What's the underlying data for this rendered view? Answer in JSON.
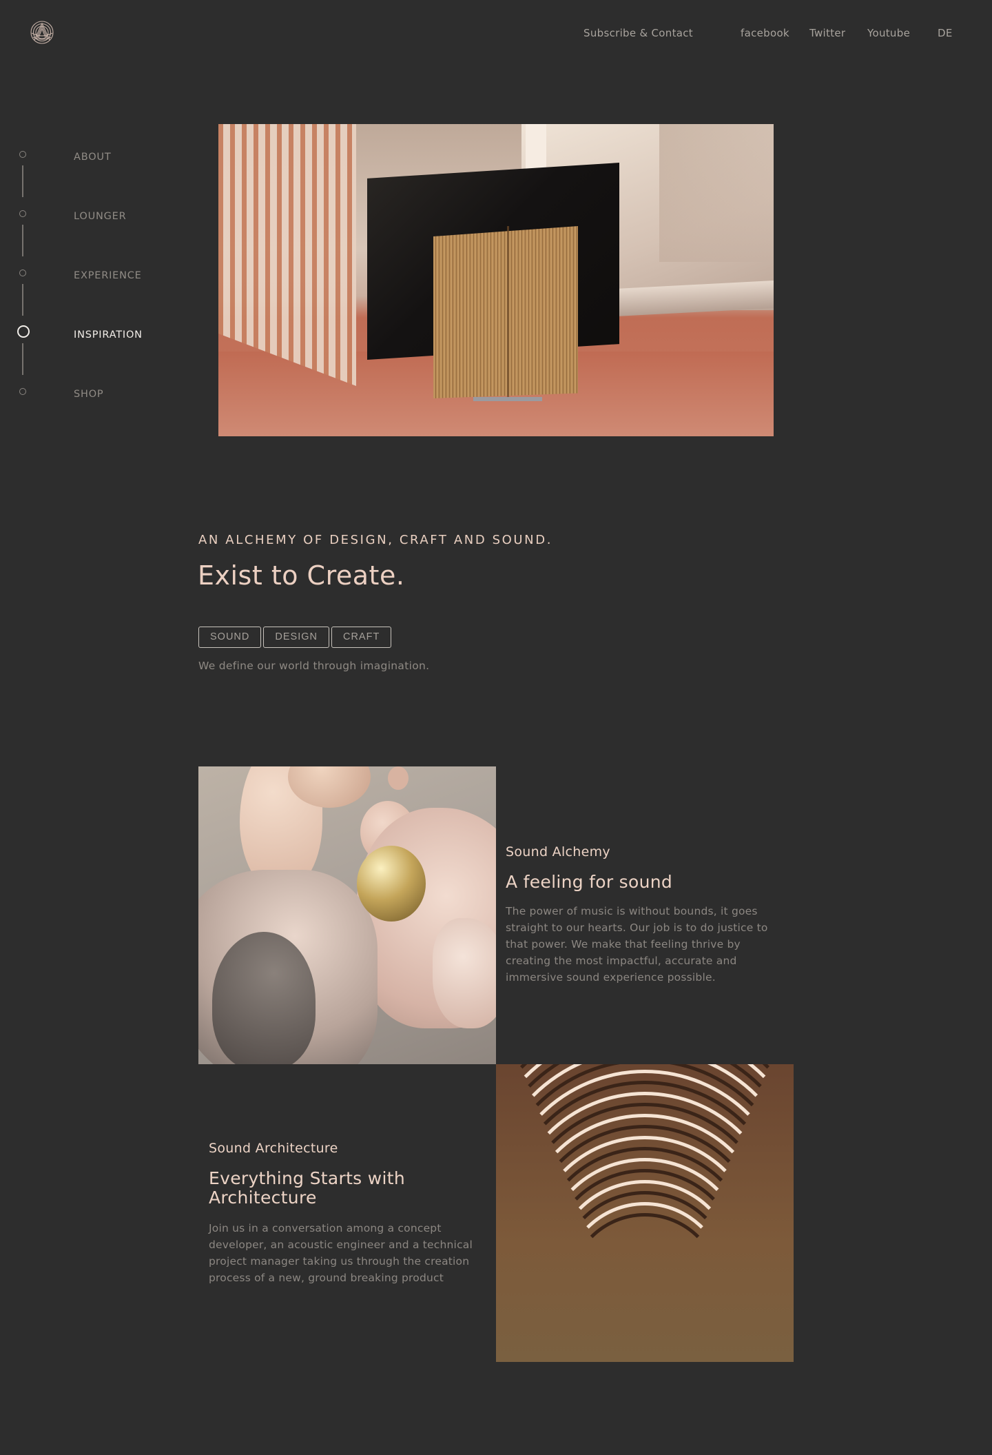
{
  "header": {
    "nav": {
      "subscribe": "Subscribe & Contact",
      "facebook": "facebook",
      "twitter": "Twitter",
      "youtube": "Youtube",
      "language": "DE"
    }
  },
  "sidenav": {
    "items": [
      {
        "label": "ABOUT",
        "active": false
      },
      {
        "label": "LOUNGER",
        "active": false
      },
      {
        "label": "EXPERIENCE",
        "active": false
      },
      {
        "label": "INSPIRATION",
        "active": true
      },
      {
        "label": "SHOP",
        "active": false
      }
    ]
  },
  "intro": {
    "eyebrow": "AN ALCHEMY OF DESIGN, CRAFT AND SOUND.",
    "headline": "Exist to Create.",
    "tags": [
      "SOUND",
      "DESIGN",
      "CRAFT"
    ],
    "subtitle": "We define our world through imagination."
  },
  "features": [
    {
      "kicker": "Sound Alchemy",
      "title": "A feeling for sound",
      "body": "The power of music is without bounds, it goes straight to our hearts. Our job is to do justice to that power. We make that feeling thrive by creating the most impactful, accurate and immersive sound experience possible."
    },
    {
      "kicker": "Sound Architecture",
      "title": "Everything Starts with Architecture",
      "body": "Join us in a conversation among a concept developer, an acoustic engineer and a technical project manager taking us through the creation process of a new, ground breaking product"
    }
  ],
  "colors": {
    "background": "#2d2d2d",
    "accent_text": "#ecd3c5",
    "muted_text": "#8c8782",
    "active_nav": "#f2eee9"
  },
  "icons": {
    "logo": "brand-logo-icon"
  }
}
